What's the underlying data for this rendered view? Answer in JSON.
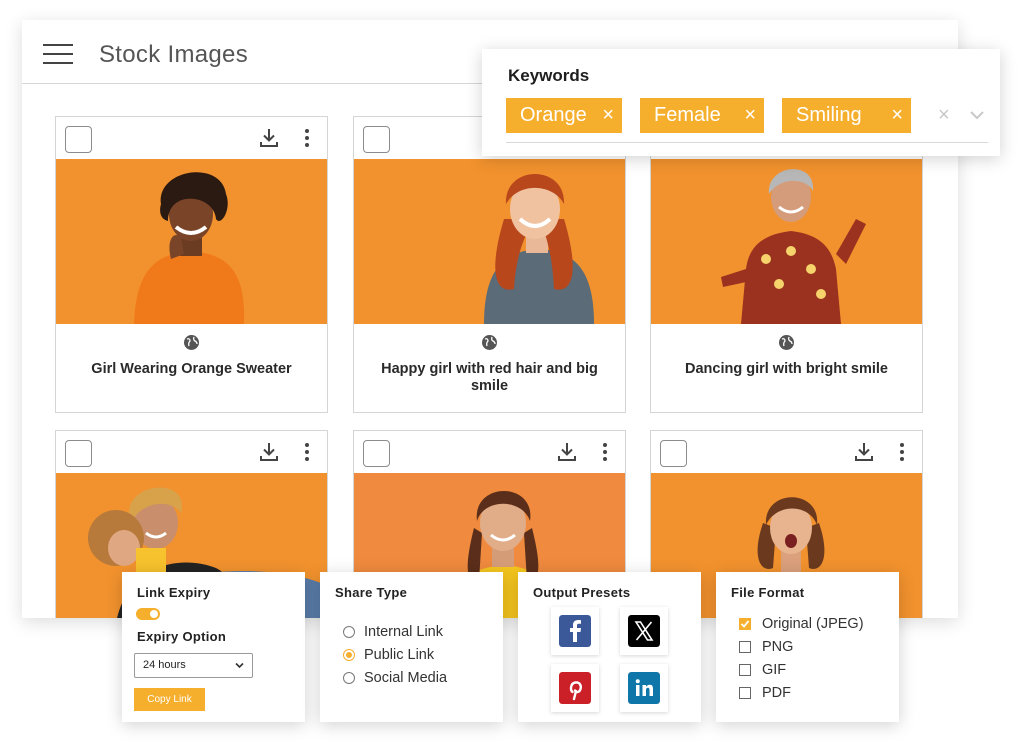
{
  "app": {
    "title": "Stock Images"
  },
  "keywords": {
    "title": "Keywords",
    "chips": [
      {
        "label": "Orange",
        "remove": "×"
      },
      {
        "label": "Female",
        "remove": "×"
      },
      {
        "label": "Smiling",
        "remove": "×"
      }
    ],
    "clear": "×"
  },
  "cards": [
    {
      "caption": "Girl Wearing Orange Sweater"
    },
    {
      "caption": "Happy girl with red hair and big smile"
    },
    {
      "caption": "Dancing girl with bright smile"
    },
    {
      "caption": ""
    },
    {
      "caption": ""
    },
    {
      "caption": ""
    }
  ],
  "link_expiry": {
    "title": "Link Expiry",
    "option_title": "Expiry Option",
    "selected": "24 hours",
    "button": "Copy Link"
  },
  "share_type": {
    "title": "Share Type",
    "options": [
      "Internal Link",
      "Public Link",
      "Social Media"
    ],
    "selected": "Public Link"
  },
  "output_presets": {
    "title": "Output Presets",
    "icons": [
      "facebook-icon",
      "x-icon",
      "pinterest-icon",
      "linkedin-icon"
    ]
  },
  "file_format": {
    "title": "File Format",
    "options": [
      "Original (JPEG)",
      "PNG",
      "GIF",
      "PDF"
    ],
    "checked": "Original (JPEG)"
  },
  "colors": {
    "accent": "#f6ae2d",
    "photo_background": "#f2922e",
    "facebook": "#3b5998",
    "x": "#000000",
    "pinterest": "#cb2027",
    "linkedin": "#0e76a8"
  }
}
